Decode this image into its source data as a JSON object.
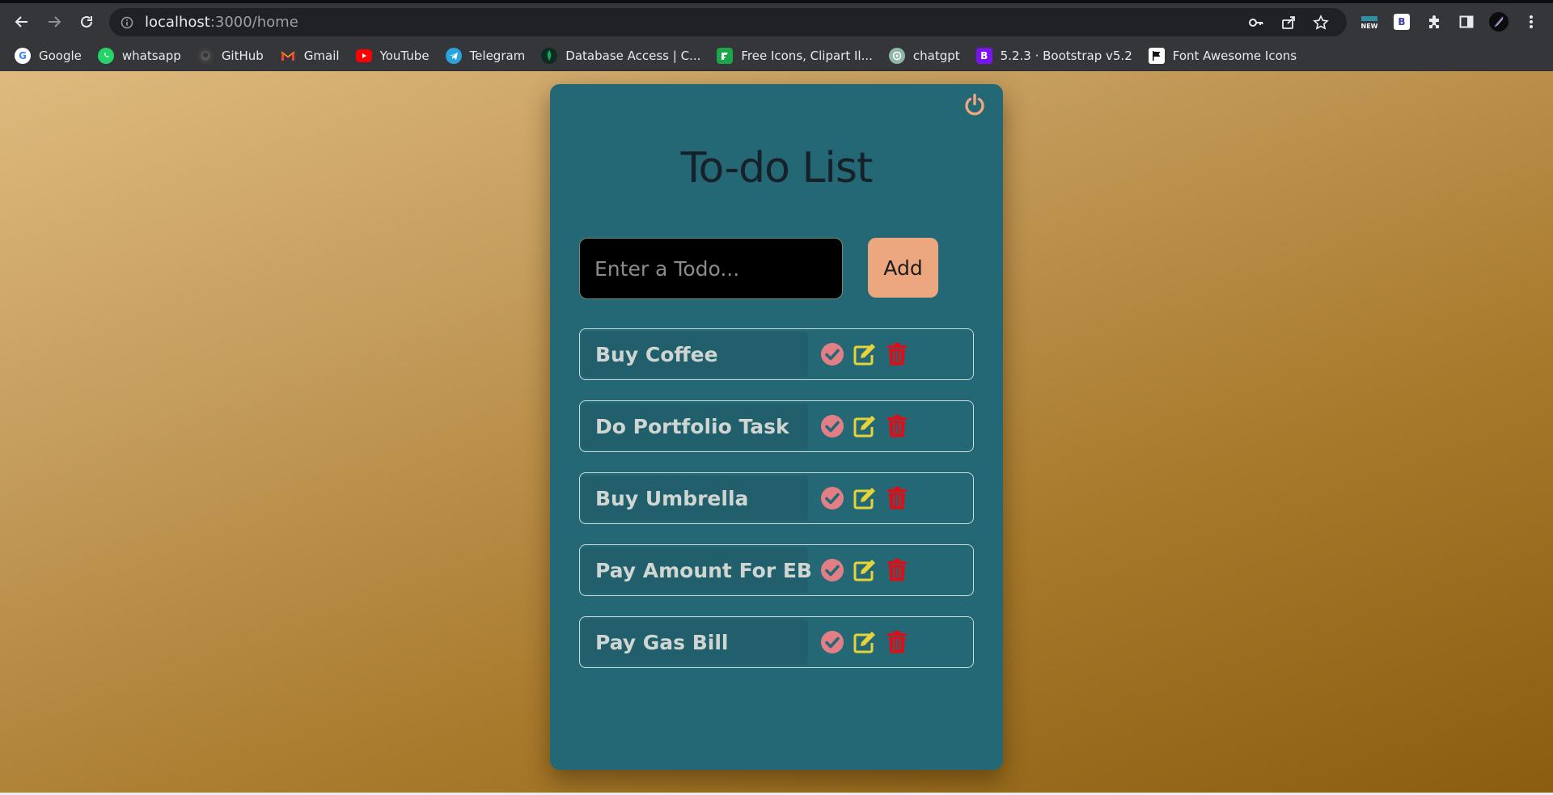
{
  "browser": {
    "url_host": "localhost",
    "url_path": ":3000/home",
    "bookmarks": [
      {
        "label": "Google",
        "icon": "google-icon"
      },
      {
        "label": "whatsapp",
        "icon": "whatsapp-icon"
      },
      {
        "label": "GitHub",
        "icon": "github-icon"
      },
      {
        "label": "Gmail",
        "icon": "gmail-icon"
      },
      {
        "label": "YouTube",
        "icon": "youtube-icon"
      },
      {
        "label": "Telegram",
        "icon": "telegram-icon"
      },
      {
        "label": "Database Access | C...",
        "icon": "mongodb-icon"
      },
      {
        "label": "Free Icons, Clipart Il...",
        "icon": "flaticon-icon"
      },
      {
        "label": "chatgpt",
        "icon": "chatgpt-icon"
      },
      {
        "label": "5.2.3 · Bootstrap v5.2",
        "icon": "bootstrap-icon"
      },
      {
        "label": "Font Awesome Icons",
        "icon": "fontawesome-icon"
      }
    ],
    "new_badge": "NEW",
    "bootstrap_ext": "B"
  },
  "app": {
    "title": "To-do List",
    "input_placeholder": "Enter a Todo...",
    "add_label": "Add",
    "todos": [
      {
        "text": "Buy Coffee"
      },
      {
        "text": "Do Portfolio Task"
      },
      {
        "text": "Buy Umbrella"
      },
      {
        "text": "Pay Amount For EB"
      },
      {
        "text": "Pay Gas Bill"
      }
    ]
  },
  "colors": {
    "card_bg": "#236874",
    "add_button": "#eca77f",
    "check_icon": "#e27f86",
    "edit_icon": "#e6d33a",
    "delete_icon": "#d8101a",
    "power_icon": "#eca77f"
  }
}
